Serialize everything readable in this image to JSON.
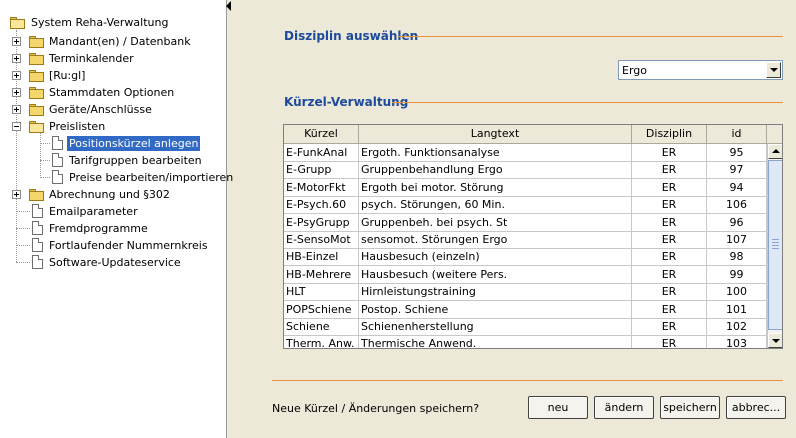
{
  "tree": {
    "root": "System Reha-Verwaltung",
    "items": [
      {
        "label": "Mandant(en) / Datenbank"
      },
      {
        "label": "Terminkalender"
      },
      {
        "label": "[Ru:gl]"
      },
      {
        "label": "Stammdaten Optionen"
      },
      {
        "label": "Geräte/Anschlüsse"
      },
      {
        "label": "Preislisten"
      },
      {
        "label": "Positionskürzel anlegen"
      },
      {
        "label": "Tarifgruppen bearbeiten"
      },
      {
        "label": "Preise bearbeiten/importieren"
      },
      {
        "label": "Abrechnung und §302"
      },
      {
        "label": "Emailparameter"
      },
      {
        "label": "Fremdprogramme"
      },
      {
        "label": "Fortlaufender Nummernkreis"
      },
      {
        "label": "Software-Updateservice"
      }
    ]
  },
  "discipline": {
    "title": "Disziplin auswählen",
    "selected": "Ergo"
  },
  "codes": {
    "title": "Kürzel-Verwaltung",
    "columns": [
      "Kürzel",
      "Langtext",
      "Disziplin",
      "id"
    ],
    "rows": [
      [
        "E-FunkAnal",
        "Ergoth. Funktionsanalyse",
        "ER",
        "95"
      ],
      [
        "E-Grupp",
        "Gruppenbehandlung Ergo",
        "ER",
        "97"
      ],
      [
        "E-MotorFkt",
        "Ergoth bei motor. Störung",
        "ER",
        "94"
      ],
      [
        "E-Psych.60",
        "psych. Störungen, 60 Min.",
        "ER",
        "106"
      ],
      [
        "E-PsyGrupp",
        "Gruppenbeh. bei psych. St",
        "ER",
        "96"
      ],
      [
        "E-SensoMot",
        "sensomot. Störungen Ergo",
        "ER",
        "107"
      ],
      [
        "HB-Einzel",
        "Hausbesuch (einzeln)",
        "ER",
        "98"
      ],
      [
        "HB-Mehrere",
        "Hausbesuch (weitere Pers.",
        "ER",
        "99"
      ],
      [
        "HLT",
        "Hirnleistungstraining",
        "ER",
        "100"
      ],
      [
        "POPSchiene",
        "Postop. Schiene",
        "ER",
        "101"
      ],
      [
        "Schiene",
        "Schienenherstellung",
        "ER",
        "102"
      ],
      [
        "Therm. Anw.",
        "Thermische Anwend.",
        "ER",
        "103"
      ]
    ]
  },
  "footer": {
    "prompt": "Neue Kürzel / Änderungen speichern?",
    "new_label": "neu",
    "change_label": "ändern",
    "save_label": "speichern",
    "cancel_label": "abbrec..."
  },
  "colors": {
    "section_title": "#1e4a9c",
    "section_line": "#e8903a",
    "selection": "#316ac5"
  }
}
